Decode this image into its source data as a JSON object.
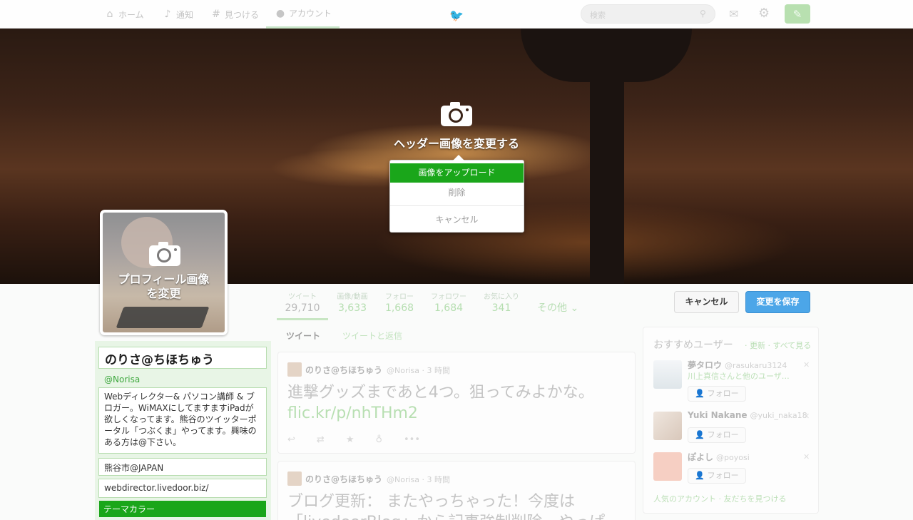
{
  "nav": {
    "home": "ホーム",
    "notifications": "通知",
    "discover": "見つける",
    "account": "アカウント",
    "search_placeholder": "検索"
  },
  "header": {
    "change_header": "ヘッダー画像を変更する",
    "menu": {
      "upload": "画像をアップロード",
      "delete": "削除",
      "cancel": "キャンセル"
    }
  },
  "avatar": {
    "change_line1": "プロフィール画像",
    "change_line2": "を変更"
  },
  "stats": [
    {
      "label": "ツイート",
      "value": "29,710"
    },
    {
      "label": "画像/動画",
      "value": "3,633"
    },
    {
      "label": "フォロー",
      "value": "1,668"
    },
    {
      "label": "フォロワー",
      "value": "1,684"
    },
    {
      "label": "お気に入り",
      "value": "341"
    }
  ],
  "more_label": "その他",
  "actions": {
    "cancel": "キャンセル",
    "save": "変更を保存"
  },
  "profile": {
    "name": "のりさ@ちほちゅう",
    "handle": "@Norisa",
    "bio": "Webディレクター& パソコン講師 & ブロガー。WiMAXにしてますますiPadが欲しくなってます。熊谷のツイッターポータル「つぶくま」やってます。興味のある方は@下さい。",
    "location": "熊谷市@JAPAN",
    "website": "webdirector.livedoor.biz/",
    "theme_color": "テーマカラー"
  },
  "tabs": {
    "tweets": "ツイート",
    "replies": "ツイートと返信"
  },
  "tweets": [
    {
      "name": "のりさ@ちほちゅう",
      "meta": "@Norisa · 3 時間",
      "text": "進撃グッズまであと4つ。狙ってみよかな。",
      "link": "flic.kr/p/nhTHm2"
    },
    {
      "name": "のりさ@ちほちゅう",
      "meta": "@Norisa · 3 時間",
      "text": "ブログ更新： またやっちゃった！今度は「livedoorBlog」から記事強制削除…やっぱ",
      "link": ""
    }
  ],
  "recommendations": {
    "title": "おすすめユーザー",
    "links": "· 更新 · すべて見る",
    "users": [
      {
        "name": "夢タロウ",
        "handle": "@rasukaru3124",
        "sub": "川上真信さんと他のユーザ…",
        "follow": "フォロー"
      },
      {
        "name": "Yuki Nakane",
        "handle": "@yuki_naka18",
        "sub": "",
        "follow": "フォロー"
      },
      {
        "name": "ぽよし",
        "handle": "@poyosi",
        "sub": "",
        "follow": "フォロー"
      }
    ],
    "footer": "人気のアカウント · 友だちを見つける"
  },
  "colors": {
    "accent_green": "#1aa61a",
    "save_blue": "#4ca6e8"
  }
}
